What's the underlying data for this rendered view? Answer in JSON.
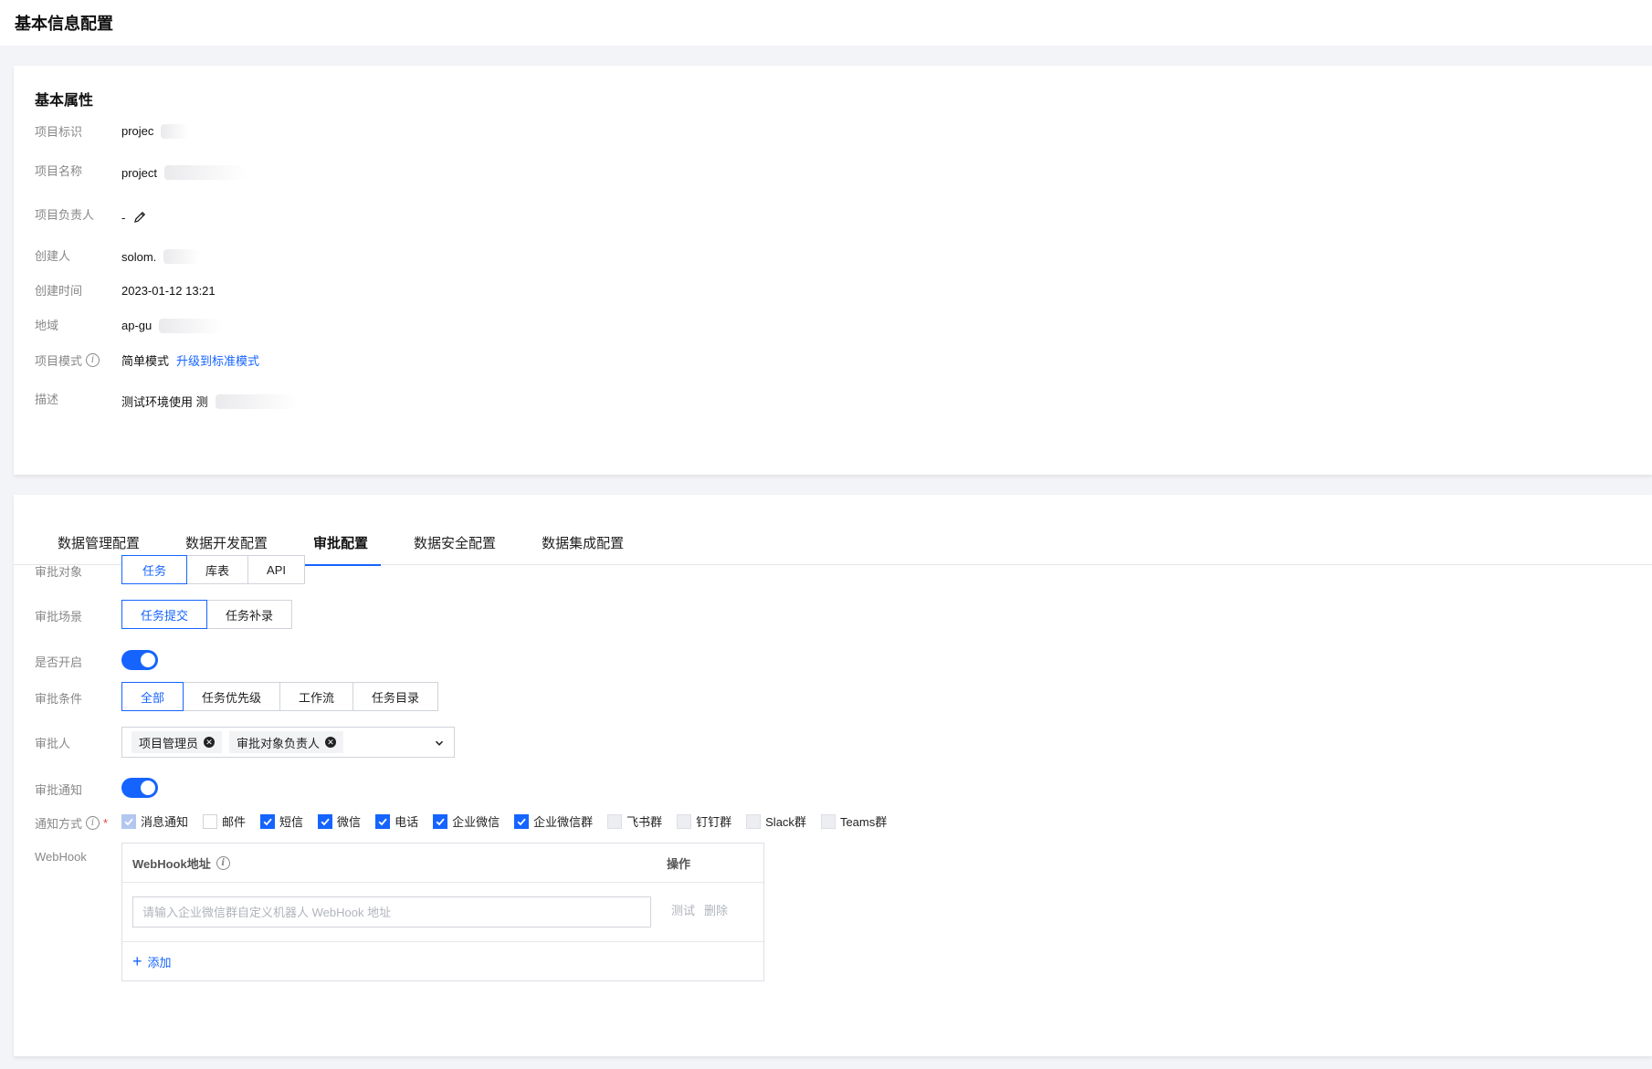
{
  "header": {
    "title": "基本信息配置"
  },
  "basic": {
    "section_title": "基本属性",
    "rows": [
      {
        "label": "项目标识",
        "value": "projec"
      },
      {
        "label": "项目名称",
        "value": "project"
      },
      {
        "label": "项目负责人",
        "value": "-"
      },
      {
        "label": "创建人",
        "value": "solom."
      },
      {
        "label": "创建时间",
        "value": "2023-01-12 13:21"
      },
      {
        "label": "地域",
        "value": "ap-gu"
      },
      {
        "label": "项目模式",
        "value": "简单模式",
        "link": "升级到标准模式"
      },
      {
        "label": "描述",
        "value": "测试环境使用 测"
      }
    ]
  },
  "tabs": [
    "数据管理配置",
    "数据开发配置",
    "审批配置",
    "数据安全配置",
    "数据集成配置"
  ],
  "active_tab": "审批配置",
  "approval": {
    "object": {
      "label": "审批对象",
      "options": [
        "任务",
        "库表",
        "API"
      ],
      "selected": "任务"
    },
    "scene": {
      "label": "审批场景",
      "options": [
        "任务提交",
        "任务补录"
      ],
      "selected": "任务提交"
    },
    "enabled": {
      "label": "是否开启",
      "on": true
    },
    "condition": {
      "label": "审批条件",
      "options": [
        "全部",
        "任务优先级",
        "工作流",
        "任务目录"
      ],
      "selected": "全部"
    },
    "approvers": {
      "label": "审批人",
      "tags": [
        "项目管理员",
        "审批对象负责人"
      ]
    },
    "notify": {
      "label": "审批通知",
      "on": true
    },
    "methods": {
      "label": "通知方式",
      "items": [
        {
          "label": "消息通知",
          "state": "checked-disabled"
        },
        {
          "label": "邮件",
          "state": "unchecked"
        },
        {
          "label": "短信",
          "state": "checked"
        },
        {
          "label": "微信",
          "state": "checked"
        },
        {
          "label": "电话",
          "state": "checked"
        },
        {
          "label": "企业微信",
          "state": "checked"
        },
        {
          "label": "企业微信群",
          "state": "checked"
        },
        {
          "label": "飞书群",
          "state": "disabled"
        },
        {
          "label": "钉钉群",
          "state": "disabled"
        },
        {
          "label": "Slack群",
          "state": "disabled"
        },
        {
          "label": "Teams群",
          "state": "disabled"
        }
      ]
    },
    "webhook": {
      "label": "WebHook",
      "col_addr": "WebHook地址",
      "col_op": "操作",
      "placeholder": "请输入企业微信群自定义机器人 WebHook 地址",
      "op_test": "测试",
      "op_delete": "删除",
      "add_label": "添加"
    }
  },
  "colors": {
    "primary": "#1664ff"
  }
}
